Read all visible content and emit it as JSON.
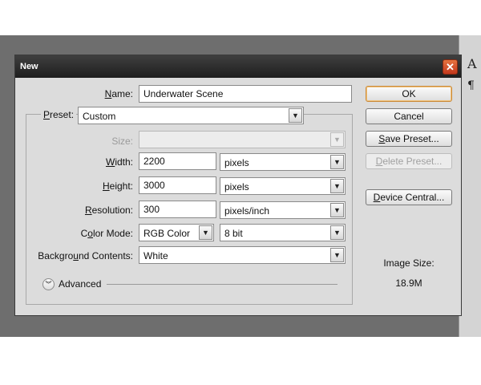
{
  "dialog": {
    "title": "New",
    "close_glyph": "✕",
    "name": {
      "label_first": "N",
      "label_rest": "ame:",
      "value": "Underwater Scene"
    },
    "preset": {
      "label_first": "P",
      "label_rest": "reset:",
      "value": "Custom"
    },
    "size": {
      "label": "Size:",
      "value": ""
    },
    "width": {
      "label_first": "W",
      "label_rest": "idth:",
      "value": "2200",
      "unit": "pixels"
    },
    "height": {
      "label_first": "H",
      "label_rest": "eight:",
      "value": "3000",
      "unit": "pixels"
    },
    "resolution": {
      "label_first": "R",
      "label_rest": "esolution:",
      "value": "300",
      "unit": "pixels/inch"
    },
    "color_mode": {
      "label_pre": "C",
      "label_u": "o",
      "label_post": "lor Mode:",
      "value": "RGB Color",
      "depth": "8 bit"
    },
    "background": {
      "label_pre": "Backgro",
      "label_u": "u",
      "label_post": "nd Contents:",
      "value": "White"
    },
    "advanced_label": "Advanced",
    "buttons": {
      "ok": "OK",
      "cancel": "Cancel",
      "save_first": "S",
      "save_rest": "ave Preset...",
      "delete_first": "D",
      "delete_rest": "elete Preset...",
      "device_first": "D",
      "device_rest": "evice Central..."
    },
    "image_size_label": "Image Size:",
    "image_size_value": "18.9M"
  },
  "right_panel": {
    "tool1": "A",
    "tool2": "¶"
  },
  "icons": {
    "dropdown": "chevron-down-icon",
    "close": "close-icon",
    "advanced": "double-chevron-down-icon"
  }
}
